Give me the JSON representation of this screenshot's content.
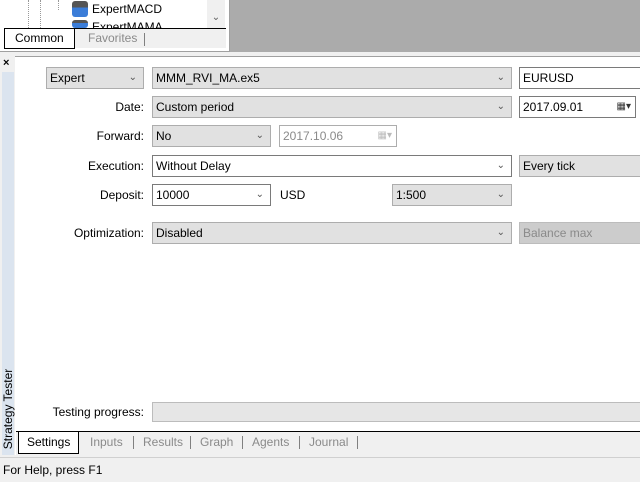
{
  "navigator": {
    "items": [
      "ExpertMACD",
      "ExpertMAMA"
    ],
    "tabs": [
      "Common",
      "Favorites"
    ]
  },
  "tester": {
    "panel_title": "Strategy Tester",
    "expert_type": "Expert",
    "expert_file": "MMM_RVI_MA.ex5",
    "symbol": "EURUSD",
    "date_label": "Date:",
    "date_mode": "Custom period",
    "date_from": "2017.09.01",
    "forward_label": "Forward:",
    "forward_mode": "No",
    "forward_date": "2017.10.06",
    "execution_label": "Execution:",
    "execution_mode": "Without Delay",
    "tick_mode": "Every tick",
    "deposit_label": "Deposit:",
    "deposit": "10000",
    "currency": "USD",
    "leverage": "1:500",
    "optimization_label": "Optimization:",
    "optimization": "Disabled",
    "criterion": "Balance max",
    "progress_label": "Testing progress:",
    "progress": 0,
    "tabs": [
      "Settings",
      "Inputs",
      "Results",
      "Graph",
      "Agents",
      "Journal"
    ]
  },
  "status": "For Help, press F1"
}
